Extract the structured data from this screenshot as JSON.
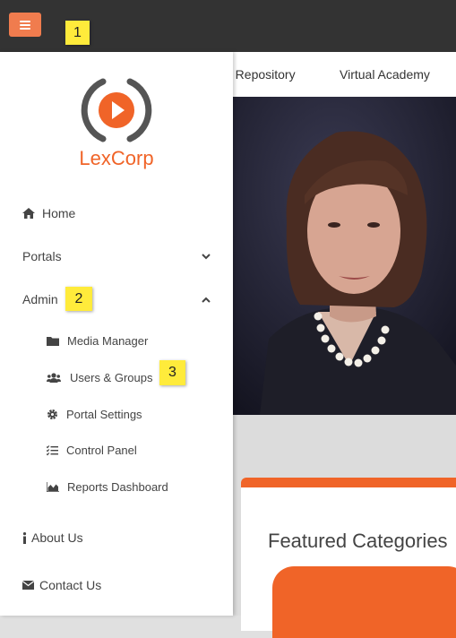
{
  "topbar": {
    "menu_button": "menu-icon"
  },
  "callouts": {
    "one": "1",
    "two": "2",
    "three": "3"
  },
  "nav": {
    "repository": "a Repository",
    "academy": "Virtual Academy"
  },
  "brand": {
    "name": "LexCorp",
    "color": "#f06428"
  },
  "sidebar": {
    "home": "Home",
    "portals": "Portals",
    "admin": "Admin",
    "admin_items": {
      "media_manager": "Media Manager",
      "users_groups": "Users & Groups",
      "portal_settings": "Portal Settings",
      "control_panel": "Control Panel",
      "reports_dashboard": "Reports Dashboard"
    },
    "about": "About Us",
    "contact": "Contact Us"
  },
  "content": {
    "featured_title": "Featured Categories"
  },
  "colors": {
    "accent": "#f06428",
    "topbar": "#333333",
    "callout": "#ffeb3b"
  }
}
